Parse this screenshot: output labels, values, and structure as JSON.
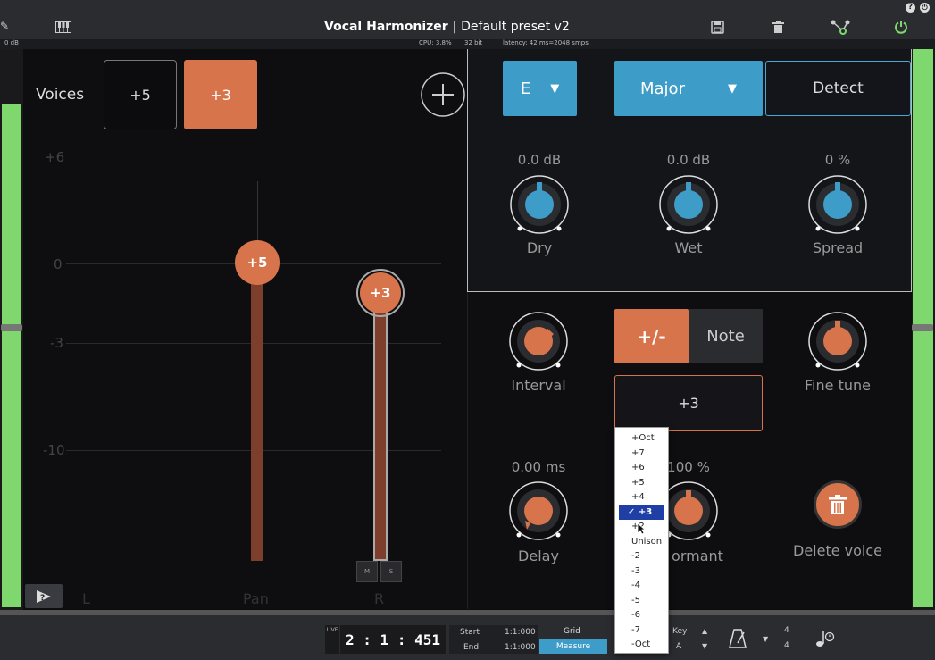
{
  "host": {
    "title_main": "Vocal Harmonizer |",
    "title_preset": "Default preset v2",
    "meter_label": "0 dB",
    "cpu": "CPU: 3.8%",
    "bits": "32 bit",
    "latency": "latency: 42 ms=2048 smps"
  },
  "voices": {
    "label": "Voices",
    "tabs": [
      {
        "label": "+5",
        "active": false
      },
      {
        "label": "+3",
        "active": true
      }
    ],
    "scale": [
      "+6",
      "0",
      "-3",
      "-10"
    ],
    "pan_labels": {
      "left": "L",
      "center": "Pan",
      "right": "R"
    },
    "faders": [
      {
        "label": "+5"
      },
      {
        "label": "+3"
      }
    ],
    "ms_buttons": [
      "M",
      "S"
    ]
  },
  "global": {
    "key": "E",
    "scale": "Major",
    "detect": "Detect",
    "knobs": [
      {
        "label": "Dry",
        "value": "0.0 dB"
      },
      {
        "label": "Wet",
        "value": "0.0 dB"
      },
      {
        "label": "Spread",
        "value": "0 %"
      }
    ]
  },
  "voice_edit": {
    "interval_label": "Interval",
    "fine_tune_label": "Fine tune",
    "mode_plusminus": "+/-",
    "mode_note": "Note",
    "interval_value": "+3",
    "delay_value": "0.00 ms",
    "delay_label": "Delay",
    "formant_value": "100 %",
    "formant_label": "ormant",
    "delete_label": "Delete voice"
  },
  "interval_menu": {
    "items": [
      "+Oct",
      "+7",
      "+6",
      "+5",
      "+4",
      "+3",
      "+2",
      "Unison",
      "-2",
      "-3",
      "-4",
      "-5",
      "-6",
      "-7",
      "-Oct"
    ],
    "selected": "+3",
    "check": "✓"
  },
  "transport": {
    "live": "LIVE",
    "position": "2 : 1 : 451",
    "start_label": "Start",
    "end_label": "End",
    "start_value": "1:1:000",
    "end_value": "1:1:000",
    "grid_label": "Grid",
    "measure_label": "Measure",
    "key_label": "Key",
    "key_value": "A",
    "sig_top": "4",
    "sig_bottom": "4"
  },
  "colors": {
    "accent_orange": "#d7744c",
    "accent_blue": "#3d9dc8",
    "meter_green": "#7ed86e"
  }
}
